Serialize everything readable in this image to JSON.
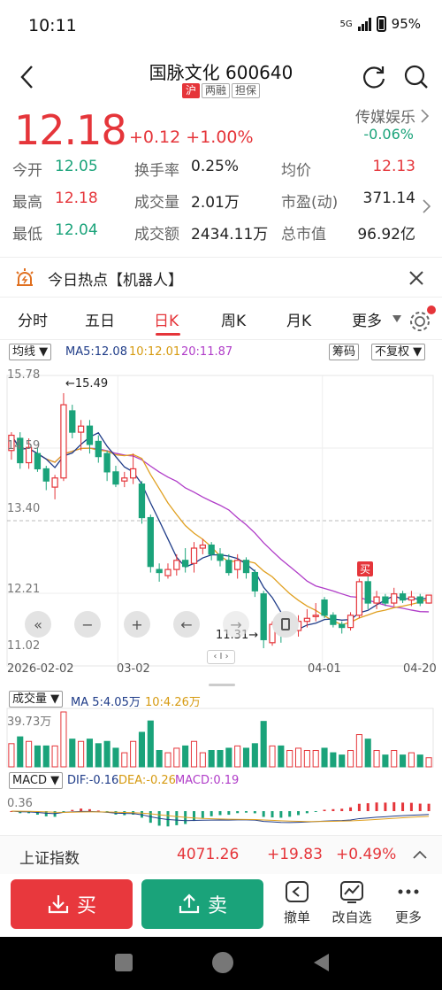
{
  "status": {
    "time": "10:11",
    "network": "5G",
    "battery": "95%"
  },
  "header": {
    "title": "国脉文化 600640",
    "tags": [
      "沪",
      "两融",
      "担保"
    ]
  },
  "quote": {
    "price": "12.18",
    "change": "+0.12",
    "change_pct": "+1.00%",
    "sector_name": "传媒娱乐",
    "sector_change": "-0.06%"
  },
  "stats": [
    [
      {
        "label": "今开",
        "value": "12.05",
        "color": "green"
      },
      {
        "label": "换手率",
        "value": "0.25%",
        "color": "plain"
      },
      {
        "label": "均价",
        "value": "12.13",
        "color": "red"
      }
    ],
    [
      {
        "label": "最高",
        "value": "12.18",
        "color": "red"
      },
      {
        "label": "成交量",
        "value": "2.01万",
        "color": "plain"
      },
      {
        "label": "市盈(动)",
        "value": "371.14",
        "color": "plain"
      }
    ],
    [
      {
        "label": "最低",
        "value": "12.04",
        "color": "green"
      },
      {
        "label": "成交额",
        "value": "2434.11万",
        "color": "plain"
      },
      {
        "label": "总市值",
        "value": "96.92亿",
        "color": "plain"
      }
    ]
  ],
  "hot": {
    "text": "今日热点【机器人】"
  },
  "tabs": [
    "分时",
    "五日",
    "日K",
    "周K",
    "月K",
    "更多"
  ],
  "kline": {
    "type_select": "均线",
    "ma5": "MA5:12.08",
    "ma10": "10:12.01",
    "ma20": "20:11.87",
    "chips_button": "筹码",
    "adjust_select": "不复权",
    "y_labels": [
      "15.78",
      "14.59",
      "13.40",
      "12.21",
      "11.02"
    ],
    "high_marker": "←15.49",
    "low_marker": "11.31→",
    "buy_marker": "买",
    "x_labels": [
      "2026-02-02",
      "03-02",
      "04-01",
      "04-20"
    ]
  },
  "volume": {
    "select": "成交量",
    "ma5": "MA 5:4.05万",
    "ma10": "10:4.26万",
    "max_label": "39.73万"
  },
  "macd": {
    "select": "MACD",
    "dif": "DIF:-0.16",
    "dea": "DEA:-0.26",
    "macd": "MACD:0.19",
    "max_label": "0.36"
  },
  "index": {
    "name": "上证指数",
    "value": "4071.26",
    "change": "+19.83",
    "change_pct": "+0.49%"
  },
  "actions": {
    "buy": "买",
    "sell": "卖",
    "cancel": "撤单",
    "watchlist": "改自选",
    "more": "更多"
  },
  "colors": {
    "up": "#e5353a",
    "down": "#1aa37a",
    "ma5": "#1f3c88",
    "ma10": "#e0a020",
    "ma20": "#b03cc8"
  },
  "chart_data": {
    "type": "candlestick",
    "ylim": [
      11.02,
      15.78
    ],
    "candles": [
      [
        14.55,
        14.8,
        14.4,
        14.85
      ],
      [
        14.75,
        14.35,
        14.25,
        14.85
      ],
      [
        14.35,
        14.6,
        14.25,
        14.75
      ],
      [
        14.5,
        14.25,
        14.2,
        14.6
      ],
      [
        14.25,
        14.05,
        13.9,
        14.3
      ],
      [
        13.95,
        14.1,
        13.75,
        14.15
      ],
      [
        14.1,
        15.3,
        14.05,
        15.49
      ],
      [
        15.2,
        14.85,
        14.75,
        15.3
      ],
      [
        14.85,
        14.95,
        14.55,
        15.05
      ],
      [
        14.95,
        14.65,
        14.5,
        15.05
      ],
      [
        14.7,
        14.45,
        14.35,
        14.8
      ],
      [
        14.5,
        14.2,
        14.05,
        14.55
      ],
      [
        14.2,
        14.0,
        13.95,
        14.3
      ],
      [
        14.05,
        14.1,
        13.95,
        14.2
      ],
      [
        14.1,
        14.25,
        14.0,
        14.5
      ],
      [
        14.0,
        13.45,
        13.35,
        14.05
      ],
      [
        13.45,
        12.65,
        12.55,
        13.5
      ],
      [
        12.6,
        12.55,
        12.4,
        12.7
      ],
      [
        12.5,
        12.6,
        12.45,
        12.7
      ],
      [
        12.6,
        12.75,
        12.5,
        12.85
      ],
      [
        12.75,
        12.65,
        12.55,
        12.95
      ],
      [
        12.7,
        12.95,
        12.55,
        13.05
      ],
      [
        12.95,
        13.0,
        12.85,
        13.1
      ],
      [
        13.0,
        12.85,
        12.75,
        13.05
      ],
      [
        12.85,
        12.75,
        12.65,
        12.95
      ],
      [
        12.75,
        12.55,
        12.5,
        12.85
      ],
      [
        12.6,
        12.75,
        12.45,
        12.85
      ],
      [
        12.75,
        12.55,
        12.45,
        12.8
      ],
      [
        12.55,
        12.25,
        12.15,
        12.6
      ],
      [
        12.2,
        11.45,
        11.31,
        12.25
      ],
      [
        11.4,
        11.7,
        11.35,
        11.75
      ],
      [
        11.7,
        11.55,
        11.4,
        11.8
      ],
      [
        11.55,
        11.65,
        11.5,
        11.8
      ],
      [
        11.6,
        11.75,
        11.5,
        11.85
      ],
      [
        11.75,
        11.8,
        11.65,
        11.95
      ],
      [
        11.85,
        11.85,
        11.75,
        12.05
      ],
      [
        12.1,
        11.85,
        11.8,
        12.15
      ],
      [
        11.85,
        11.7,
        11.65,
        11.9
      ],
      [
        11.7,
        11.65,
        11.55,
        11.75
      ],
      [
        11.65,
        11.85,
        11.6,
        11.9
      ],
      [
        11.85,
        12.4,
        11.8,
        12.45
      ],
      [
        12.4,
        12.05,
        11.95,
        12.5
      ],
      [
        12.05,
        12.15,
        11.95,
        12.25
      ],
      [
        12.15,
        12.05,
        12.0,
        12.2
      ],
      [
        12.05,
        12.2,
        12.0,
        12.3
      ],
      [
        12.2,
        12.1,
        12.05,
        12.25
      ],
      [
        12.1,
        12.15,
        12.0,
        12.25
      ],
      [
        12.15,
        12.05,
        12.0,
        12.2
      ],
      [
        12.05,
        12.18,
        12.04,
        12.18
      ]
    ],
    "volume_max": 39.73,
    "volume_unit": "万"
  }
}
